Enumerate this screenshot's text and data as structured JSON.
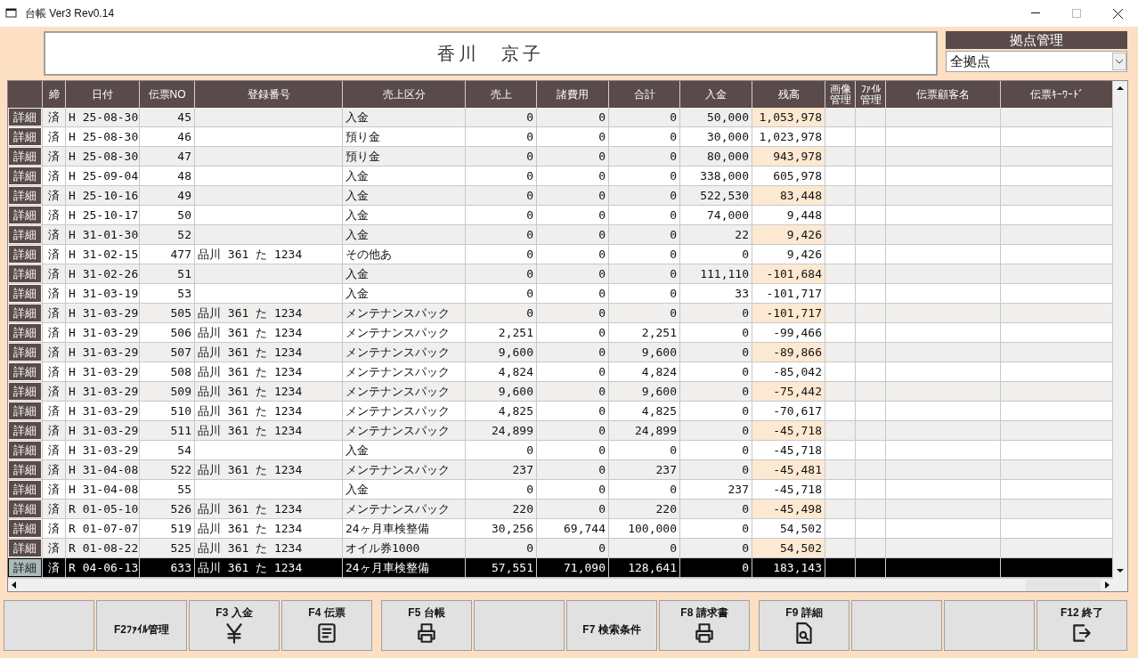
{
  "window": {
    "title": "台帳 Ver3 Rev0.14"
  },
  "customer_name": "香川　京子",
  "location": {
    "label": "拠点管理",
    "value": "全拠点"
  },
  "table": {
    "columns": [
      "締",
      "日付",
      "伝票NO",
      "登録番号",
      "売上区分",
      "売上",
      "諸費用",
      "合計",
      "入金",
      "残高",
      "画像管理",
      "ﾌｧｲﾙ管理",
      "伝票顧客名",
      "伝票ｷｰﾜｰﾄﾞ"
    ],
    "rows": [
      {
        "detail": "詳細",
        "closed": "済",
        "date": "H 25-08-30",
        "no": "45",
        "category": "入金",
        "sales": "0",
        "expenses": "0",
        "total": "0",
        "deposit": "50,000",
        "balance": "1,053,978",
        "selected": false
      },
      {
        "detail": "詳細",
        "closed": "済",
        "date": "H 25-08-30",
        "no": "46",
        "category": "預り金",
        "sales": "0",
        "expenses": "0",
        "total": "0",
        "deposit": "30,000",
        "balance": "1,023,978",
        "selected": false
      },
      {
        "detail": "詳細",
        "closed": "済",
        "date": "H 25-08-30",
        "no": "47",
        "category": "預り金",
        "sales": "0",
        "expenses": "0",
        "total": "0",
        "deposit": "80,000",
        "balance": "943,978",
        "selected": false
      },
      {
        "detail": "詳細",
        "closed": "済",
        "date": "H 25-09-04",
        "no": "48",
        "category": "入金",
        "sales": "0",
        "expenses": "0",
        "total": "0",
        "deposit": "338,000",
        "balance": "605,978",
        "selected": false
      },
      {
        "detail": "詳細",
        "closed": "済",
        "date": "H 25-10-16",
        "no": "49",
        "category": "入金",
        "sales": "0",
        "expenses": "0",
        "total": "0",
        "deposit": "522,530",
        "balance": "83,448",
        "selected": false
      },
      {
        "detail": "詳細",
        "closed": "済",
        "date": "H 25-10-17",
        "no": "50",
        "category": "入金",
        "sales": "0",
        "expenses": "0",
        "total": "0",
        "deposit": "74,000",
        "balance": "9,448",
        "selected": false
      },
      {
        "detail": "詳細",
        "closed": "済",
        "date": "H 31-01-30",
        "no": "52",
        "category": "入金",
        "sales": "0",
        "expenses": "0",
        "total": "0",
        "deposit": "22",
        "balance": "9,426",
        "selected": false
      },
      {
        "detail": "詳細",
        "closed": "済",
        "date": "H 31-02-15",
        "no": "477",
        "reg": "品川 361 た 1234",
        "category": "その他あ",
        "sales": "0",
        "expenses": "0",
        "total": "0",
        "deposit": "0",
        "balance": "9,426",
        "selected": false
      },
      {
        "detail": "詳細",
        "closed": "済",
        "date": "H 31-02-26",
        "no": "51",
        "category": "入金",
        "sales": "0",
        "expenses": "0",
        "total": "0",
        "deposit": "111,110",
        "balance": "-101,684",
        "selected": false
      },
      {
        "detail": "詳細",
        "closed": "済",
        "date": "H 31-03-19",
        "no": "53",
        "category": "入金",
        "sales": "0",
        "expenses": "0",
        "total": "0",
        "deposit": "33",
        "balance": "-101,717",
        "selected": false
      },
      {
        "detail": "詳細",
        "closed": "済",
        "date": "H 31-03-29",
        "no": "505",
        "reg": "品川 361 た 1234",
        "category": "メンテナンスパック",
        "sales": "0",
        "expenses": "0",
        "total": "0",
        "deposit": "0",
        "balance": "-101,717",
        "selected": false
      },
      {
        "detail": "詳細",
        "closed": "済",
        "date": "H 31-03-29",
        "no": "506",
        "reg": "品川 361 た 1234",
        "category": "メンテナンスパック",
        "sales": "2,251",
        "expenses": "0",
        "total": "2,251",
        "deposit": "0",
        "balance": "-99,466",
        "selected": false
      },
      {
        "detail": "詳細",
        "closed": "済",
        "date": "H 31-03-29",
        "no": "507",
        "reg": "品川 361 た 1234",
        "category": "メンテナンスパック",
        "sales": "9,600",
        "expenses": "0",
        "total": "9,600",
        "deposit": "0",
        "balance": "-89,866",
        "selected": false
      },
      {
        "detail": "詳細",
        "closed": "済",
        "date": "H 31-03-29",
        "no": "508",
        "reg": "品川 361 た 1234",
        "category": "メンテナンスパック",
        "sales": "4,824",
        "expenses": "0",
        "total": "4,824",
        "deposit": "0",
        "balance": "-85,042",
        "selected": false
      },
      {
        "detail": "詳細",
        "closed": "済",
        "date": "H 31-03-29",
        "no": "509",
        "reg": "品川 361 た 1234",
        "category": "メンテナンスパック",
        "sales": "9,600",
        "expenses": "0",
        "total": "9,600",
        "deposit": "0",
        "balance": "-75,442",
        "selected": false
      },
      {
        "detail": "詳細",
        "closed": "済",
        "date": "H 31-03-29",
        "no": "510",
        "reg": "品川 361 た 1234",
        "category": "メンテナンスパック",
        "sales": "4,825",
        "expenses": "0",
        "total": "4,825",
        "deposit": "0",
        "balance": "-70,617",
        "selected": false
      },
      {
        "detail": "詳細",
        "closed": "済",
        "date": "H 31-03-29",
        "no": "511",
        "reg": "品川 361 た 1234",
        "category": "メンテナンスパック",
        "sales": "24,899",
        "expenses": "0",
        "total": "24,899",
        "deposit": "0",
        "balance": "-45,718",
        "selected": false
      },
      {
        "detail": "詳細",
        "closed": "済",
        "date": "H 31-03-29",
        "no": "54",
        "category": "入金",
        "sales": "0",
        "expenses": "0",
        "total": "0",
        "deposit": "0",
        "balance": "-45,718",
        "selected": false
      },
      {
        "detail": "詳細",
        "closed": "済",
        "date": "H 31-04-08",
        "no": "522",
        "reg": "品川 361 た 1234",
        "category": "メンテナンスパック",
        "sales": "237",
        "expenses": "0",
        "total": "237",
        "deposit": "0",
        "balance": "-45,481",
        "selected": false
      },
      {
        "detail": "詳細",
        "closed": "済",
        "date": "H 31-04-08",
        "no": "55",
        "category": "入金",
        "sales": "0",
        "expenses": "0",
        "total": "0",
        "deposit": "237",
        "balance": "-45,718",
        "selected": false
      },
      {
        "detail": "詳細",
        "closed": "済",
        "date": "R 01-05-10",
        "no": "526",
        "reg": "品川 361 た 1234",
        "category": "メンテナンスパック",
        "sales": "220",
        "expenses": "0",
        "total": "220",
        "deposit": "0",
        "balance": "-45,498",
        "selected": false
      },
      {
        "detail": "詳細",
        "closed": "済",
        "date": "R 01-07-07",
        "no": "519",
        "reg": "品川 361 た 1234",
        "category": "24ヶ月車検整備",
        "sales": "30,256",
        "expenses": "69,744",
        "total": "100,000",
        "deposit": "0",
        "balance": "54,502",
        "selected": false
      },
      {
        "detail": "詳細",
        "closed": "済",
        "date": "R 01-08-22",
        "no": "525",
        "reg": "品川 361 た 1234",
        "category": "オイル券1000",
        "sales": "0",
        "expenses": "0",
        "total": "0",
        "deposit": "0",
        "balance": "54,502",
        "selected": false
      },
      {
        "detail": "詳細",
        "closed": "済",
        "date": "R 04-06-13",
        "no": "633",
        "reg": "品川 361 た 1234",
        "category": "24ヶ月車検整備",
        "sales": "57,551",
        "expenses": "71,090",
        "total": "128,641",
        "deposit": "0",
        "balance": "183,143",
        "selected": true
      }
    ]
  },
  "function_keys": [
    {
      "kind": "blank"
    },
    {
      "kind": "text",
      "label": "F2ﾌｧｲﾙ管理"
    },
    {
      "kind": "yen",
      "label": "F3 入金"
    },
    {
      "kind": "document",
      "label": "F4 伝票"
    },
    {
      "kind": "printer",
      "label": "F5 台帳"
    },
    {
      "kind": "blank"
    },
    {
      "kind": "text",
      "label": "F7 検索条件"
    },
    {
      "kind": "printer",
      "label": "F8 請求書"
    },
    {
      "kind": "search-document",
      "label": "F9 詳細"
    },
    {
      "kind": "blank"
    },
    {
      "kind": "blank"
    },
    {
      "kind": "exit",
      "label": "F12 終了"
    }
  ]
}
